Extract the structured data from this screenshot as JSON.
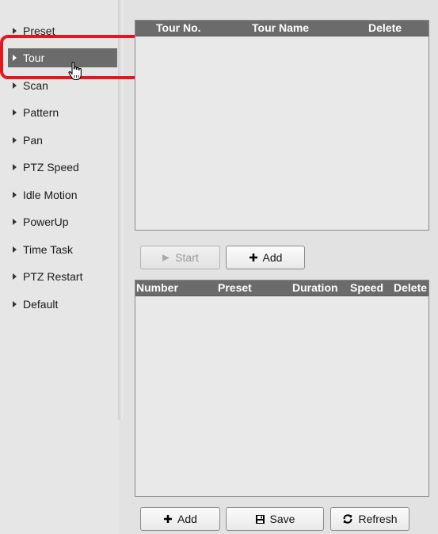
{
  "sidebar": {
    "items": [
      {
        "label": "Preset"
      },
      {
        "label": "Tour"
      },
      {
        "label": "Scan"
      },
      {
        "label": "Pattern"
      },
      {
        "label": "Pan"
      },
      {
        "label": "PTZ Speed"
      },
      {
        "label": "Idle Motion"
      },
      {
        "label": "PowerUp"
      },
      {
        "label": "Time Task"
      },
      {
        "label": "PTZ Restart"
      },
      {
        "label": "Default"
      }
    ],
    "active": "Tour"
  },
  "tour_table": {
    "columns": [
      "Tour No.",
      "Tour Name",
      "Delete"
    ],
    "rows": []
  },
  "tour_buttons": {
    "start_label": "Start",
    "add_label": "Add"
  },
  "preset_table": {
    "columns": [
      "Number",
      "Preset",
      "Duration",
      "Speed",
      "Delete"
    ],
    "rows": []
  },
  "bottom_buttons": {
    "add_label": "Add",
    "save_label": "Save",
    "refresh_label": "Refresh"
  },
  "colors": {
    "highlight": "#e8141e",
    "header": "#6b6b6b",
    "active_item": "#6b6b6b"
  }
}
